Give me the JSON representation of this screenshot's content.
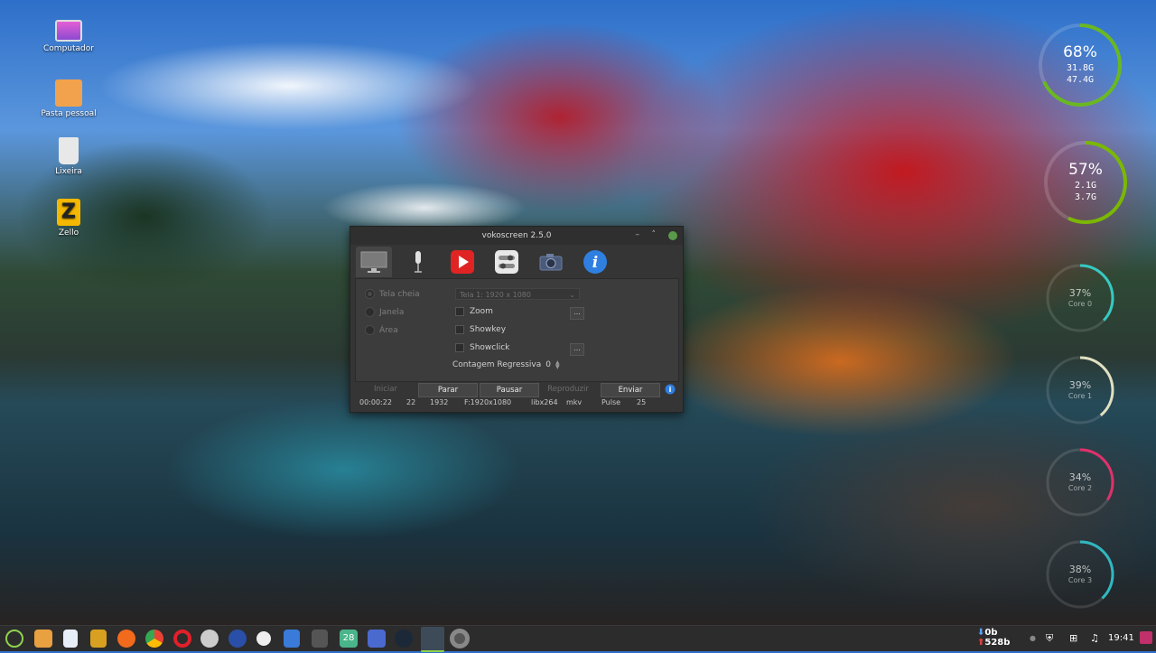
{
  "desktop": {
    "icons": [
      {
        "label": "Computador",
        "icon": "computer-icon"
      },
      {
        "label": "Pasta pessoal",
        "icon": "home-folder-icon"
      },
      {
        "label": "Lixeira",
        "icon": "trash-icon"
      },
      {
        "label": "Zello",
        "icon": "zello-icon"
      }
    ]
  },
  "meters": {
    "ram": {
      "percent": "68%",
      "used": "31.8G",
      "total": "47.4G",
      "level": 0.68,
      "color": "#6ab820"
    },
    "swap": {
      "percent": "57%",
      "used": "2.1G",
      "total": "3.7G",
      "level": 0.57,
      "color": "#7ab800"
    },
    "cores": [
      {
        "percent": "37%",
        "label": "Core 0",
        "level": 0.37,
        "color": "#35c9c2"
      },
      {
        "percent": "39%",
        "label": "Core 1",
        "level": 0.39,
        "color": "#e0e0c0"
      },
      {
        "percent": "34%",
        "label": "Core 2",
        "level": 0.34,
        "color": "#e0306a"
      },
      {
        "percent": "38%",
        "label": "Core 3",
        "level": 0.38,
        "color": "#30b8c0"
      }
    ]
  },
  "window": {
    "title": "vokoscreen 2.5.0",
    "tabs": [
      {
        "name": "screen-tab",
        "icon": "monitor-icon"
      },
      {
        "name": "audio-tab",
        "icon": "microphone-icon"
      },
      {
        "name": "video-tab",
        "icon": "play-icon"
      },
      {
        "name": "settings-tab",
        "icon": "toggles-icon"
      },
      {
        "name": "webcam-tab",
        "icon": "camera-icon"
      },
      {
        "name": "info-tab",
        "icon": "info-icon"
      }
    ],
    "radios": {
      "fullscreen": "Tela cheia",
      "window": "Janela",
      "area": "Área"
    },
    "screen_select": "Tela 1:  1920 x 1080",
    "checks": {
      "zoom": "Zoom",
      "showkey": "Showkey",
      "showclick": "Showclick"
    },
    "dots": "...",
    "countdown_label": "Contagem Regressiva",
    "countdown_value": "0",
    "buttons": {
      "start": "Iniciar",
      "stop": "Parar",
      "pause": "Pausar",
      "play": "Reproduzir",
      "send": "Enviar"
    },
    "status": {
      "time": "00:00:22",
      "fps": "22",
      "frames": "1932",
      "format": "F:1920x1080",
      "codec": "libx264",
      "container": "mkv",
      "audio": "Pulse",
      "rate": "25"
    }
  },
  "taskbar": {
    "net_down": "0b",
    "net_up": "528b",
    "clock": "19:41",
    "calendar_day": "28"
  }
}
